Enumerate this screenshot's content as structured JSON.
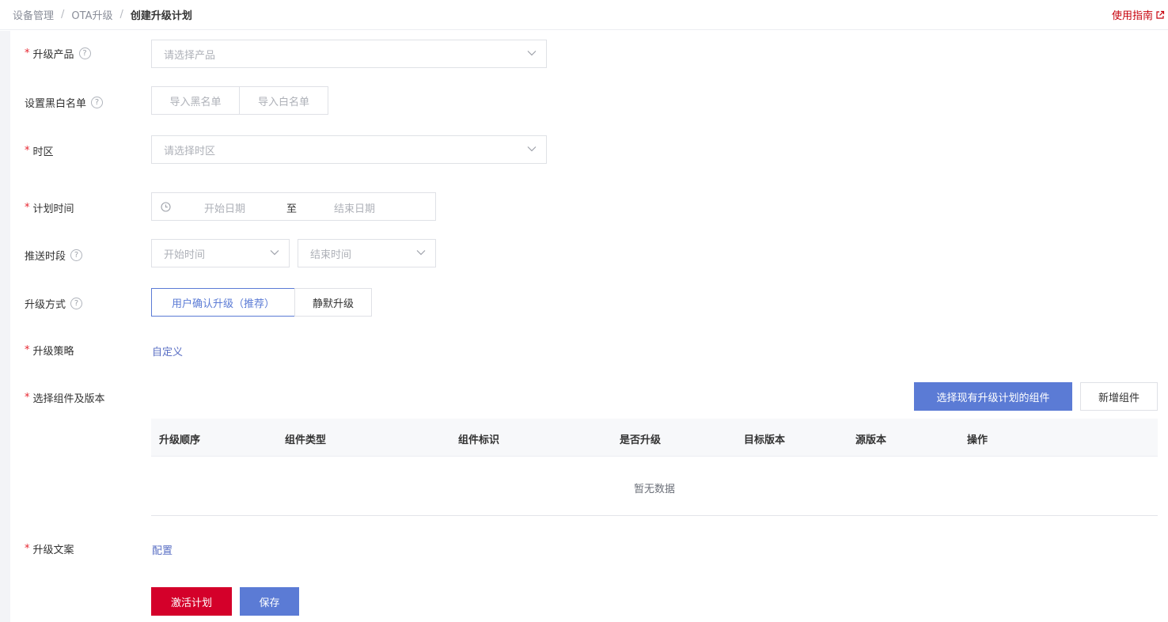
{
  "breadcrumb": {
    "items": [
      "设备管理",
      "OTA升级"
    ],
    "separator": "/",
    "current": "创建升级计划"
  },
  "header": {
    "guide_label": "使用指南"
  },
  "form": {
    "product": {
      "label": "升级产品",
      "placeholder": "请选择产品"
    },
    "blackwhite": {
      "label": "设置黑白名单",
      "import_black": "导入黑名单",
      "import_white": "导入白名单"
    },
    "timezone": {
      "label": "时区",
      "placeholder": "请选择时区"
    },
    "schedule": {
      "label": "计划时间",
      "start_placeholder": "开始日期",
      "separator": "至",
      "end_placeholder": "结束日期"
    },
    "push_period": {
      "label": "推送时段",
      "start_placeholder": "开始时间",
      "end_placeholder": "结束时间"
    },
    "upgrade_mode": {
      "label": "升级方式",
      "options": [
        "用户确认升级（推荐）",
        "静默升级"
      ],
      "selected": "用户确认升级（推荐）"
    },
    "strategy": {
      "label": "升级策略",
      "link": "自定义"
    },
    "components": {
      "label": "选择组件及版本",
      "select_existing_button": "选择现有升级计划的组件",
      "add_button": "新增组件",
      "columns": [
        "升级顺序",
        "组件类型",
        "组件标识",
        "是否升级",
        "目标版本",
        "源版本",
        "操作"
      ],
      "empty_text": "暂无数据"
    },
    "copywriting": {
      "label": "升级文案",
      "link": "配置"
    }
  },
  "actions": {
    "activate_label": "激活计划",
    "save_label": "保存"
  },
  "colors": {
    "primary": "#5b7bd5",
    "danger": "#d4002a",
    "link": "#5a6fc4",
    "required": "#e6252f"
  }
}
